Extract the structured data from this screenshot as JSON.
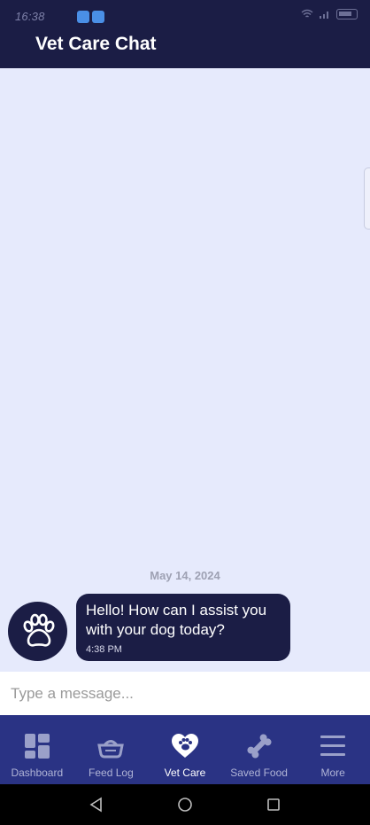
{
  "status_bar": {
    "time": "16:38"
  },
  "header": {
    "title": "Vet Care Chat"
  },
  "chat": {
    "date_separator": "May 14, 2024",
    "messages": [
      {
        "sender_avatar_icon": "paw-icon",
        "text": "Hello! How can I assist you with your dog today?",
        "time": "4:38 PM"
      }
    ]
  },
  "composer": {
    "placeholder": "Type a message..."
  },
  "bottom_nav": {
    "active": "Vet Care",
    "items": [
      {
        "label": "Dashboard",
        "icon": "dashboard-icon"
      },
      {
        "label": "Feed Log",
        "icon": "food-bowl-icon"
      },
      {
        "label": "Vet Care",
        "icon": "heart-paw-icon"
      },
      {
        "label": "Saved Food",
        "icon": "bone-icon"
      },
      {
        "label": "More",
        "icon": "menu-icon"
      }
    ]
  },
  "colors": {
    "header": "#1b1d45",
    "nav": "#2a3384",
    "chat_bg": "#e6eafc",
    "bubble": "#1b1d45"
  }
}
